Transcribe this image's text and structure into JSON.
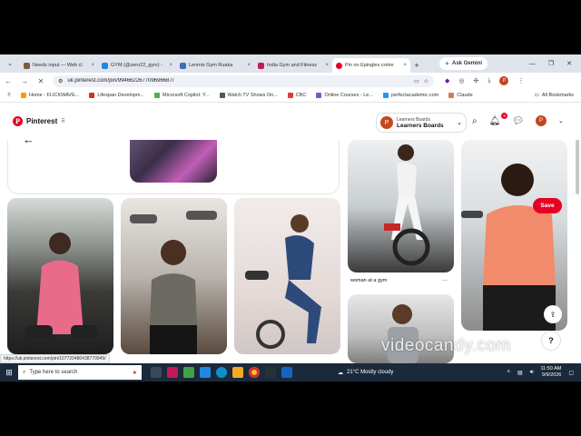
{
  "browser": {
    "tabs": [
      {
        "label": "Needs input — Web cl",
        "color": "#7d5b3b",
        "active": false
      },
      {
        "label": "GYM (@zero22_gym) -",
        "color": "#1e88e5",
        "active": false
      },
      {
        "label": "Lenmix Gym Ruaka",
        "color": "#3d6fb6",
        "active": false
      },
      {
        "label": "India Gym and Fitness",
        "color": "#c2185b",
        "active": false
      },
      {
        "label": "Pin on Epingles créée",
        "color": "#e60023",
        "active": true
      }
    ],
    "new_tab": "+",
    "ask_gemini": "Ask Gemini",
    "url": "uk.pinterest.com/pin/994662267709696687/",
    "bookmarks": [
      {
        "label": "Home - FLICKWAVE...",
        "color": "#ff9800"
      },
      {
        "label": "Lifespan Developm...",
        "color": "#d32f2f"
      },
      {
        "label": "Microsoft Copilot: Y...",
        "color": "#4caf50"
      },
      {
        "label": "Watch TV Shows On...",
        "color": "#555555"
      },
      {
        "label": "CBC",
        "color": "#e53935"
      },
      {
        "label": "Online Courses - Le...",
        "color": "#7e57c2"
      },
      {
        "label": "perfectacademic.com",
        "color": "#2196f3"
      },
      {
        "label": "Claude",
        "color": "#d97757"
      }
    ],
    "all_bookmarks": "All Bookmarks",
    "status_url": "https://uk.pinterest.com/pin/10772048043877094​9/"
  },
  "pinterest": {
    "brand": "Pinterest",
    "account_sub": "Learners Boards",
    "account_name": "Learners Boards",
    "account_initial": "P",
    "notifications": "3",
    "save": "Save",
    "caption_woman_gym": "woman at a gym",
    "more": "..."
  },
  "watermark": "videocandy.com",
  "taskbar": {
    "search_placeholder": "Type here to search",
    "weather": "21°C  Mostly cloudy",
    "time": "11:50 AM",
    "date": "9/9/2026"
  },
  "colors": {
    "pinterest_red": "#e60023",
    "taskbar": "#1b2a3a"
  }
}
